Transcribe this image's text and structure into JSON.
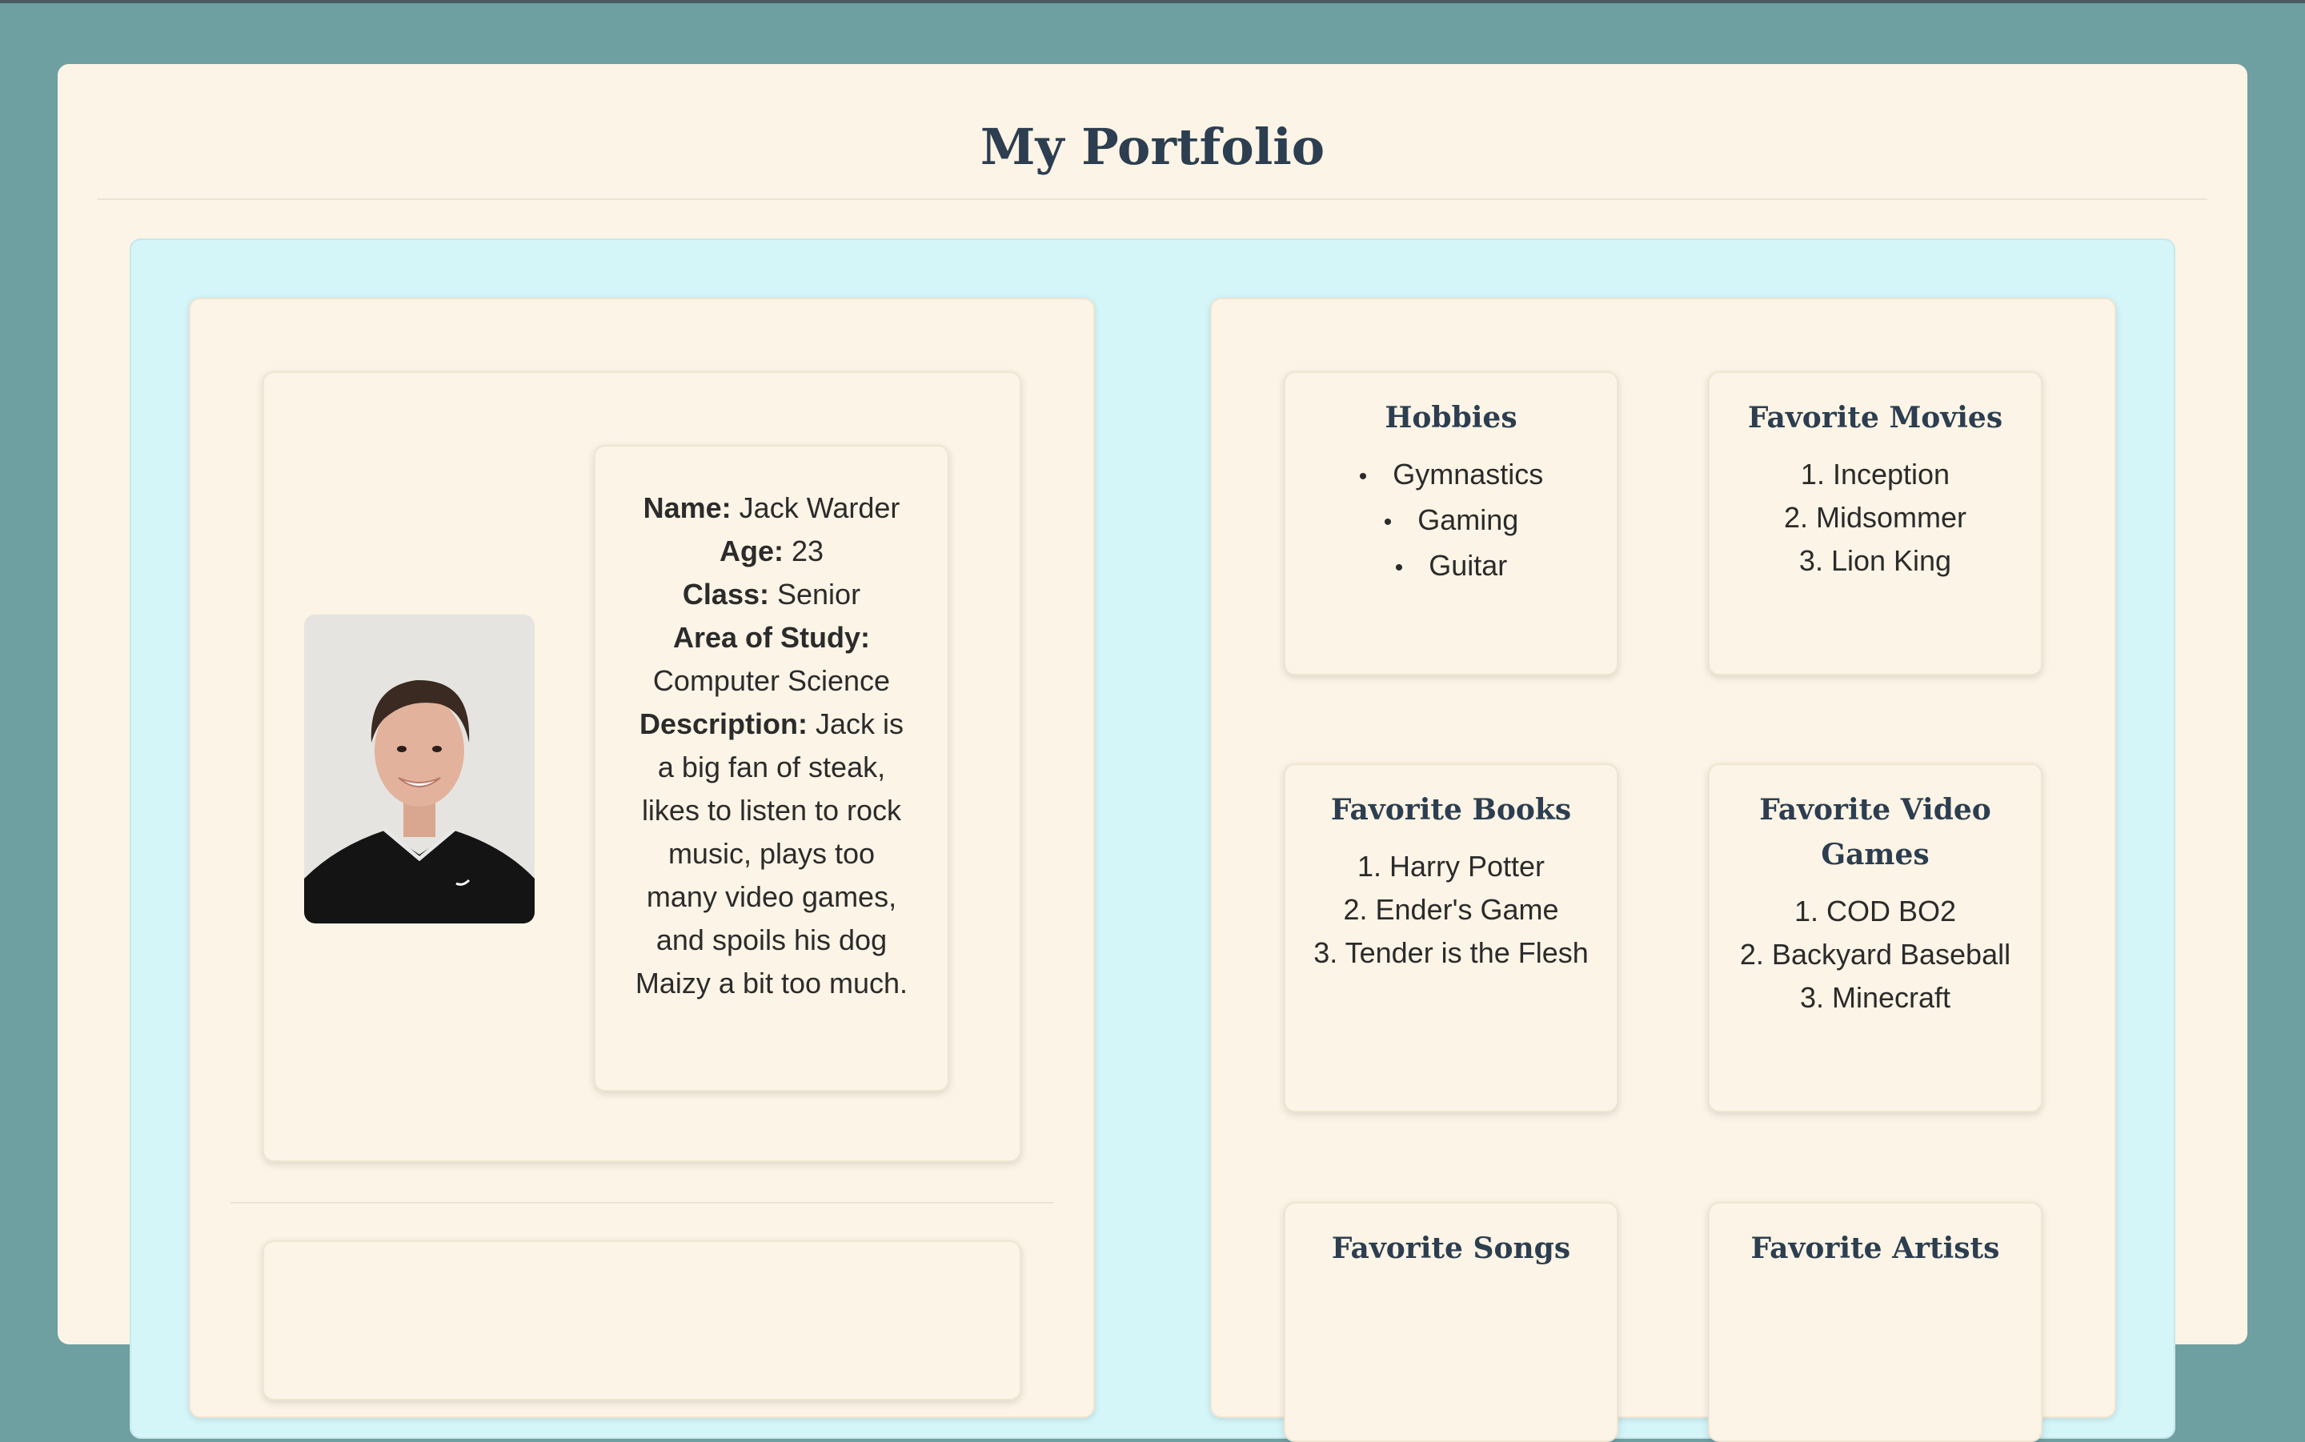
{
  "page": {
    "title": "My Portfolio"
  },
  "profile": {
    "photo_alt": "Photo of Jack Warder",
    "name_label": "Name:",
    "name": "Jack Warder",
    "age_label": "Age:",
    "age": "23",
    "class_label": "Class:",
    "class": "Senior",
    "study_label": "Area of Study:",
    "study": "Computer Science",
    "description_label": "Description:",
    "description": "Jack is a big fan of steak, likes to listen to rock music, plays too many video games, and spoils his dog Maizy a bit too much."
  },
  "favorites": {
    "hobbies": {
      "title": "Hobbies",
      "items": [
        "Gymnastics",
        "Gaming",
        "Guitar"
      ]
    },
    "movies": {
      "title": "Favorite Movies",
      "items": [
        "1. Inception",
        "2. Midsommer",
        "3. Lion King"
      ]
    },
    "books": {
      "title": "Favorite Books",
      "items": [
        "1. Harry Potter",
        "2. Ender's Game",
        "3. Tender is the Flesh"
      ]
    },
    "games": {
      "title_line1": "Favorite Video",
      "title_line2": "Games",
      "items": [
        "1. COD BO2",
        "2. Backyard Baseball",
        "3. Minecraft"
      ]
    },
    "songs": {
      "title": "Favorite Songs"
    },
    "artists": {
      "title": "Favorite Artists"
    }
  },
  "colors": {
    "background": "#6e9fa1",
    "card": "#fcf4e6",
    "wrapper": "#d4f6f9",
    "heading": "#2c3e50"
  }
}
